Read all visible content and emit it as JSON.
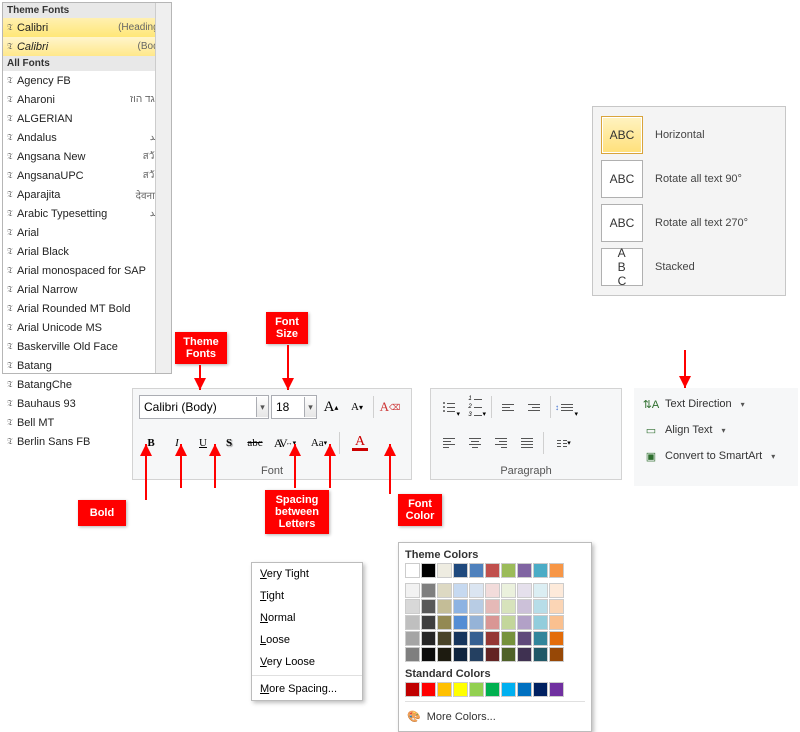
{
  "font_panel": {
    "theme_header": "Theme Fonts",
    "theme_fonts": [
      {
        "name": "Calibri",
        "meta": "(Headings)"
      },
      {
        "name": "Calibri",
        "meta": "(Body)"
      }
    ],
    "all_header": "All Fonts",
    "all_fonts": [
      {
        "name": "Agency FB",
        "meta": ""
      },
      {
        "name": "Aharoni",
        "meta": "אבגד הוז"
      },
      {
        "name": "ALGERIAN",
        "meta": ""
      },
      {
        "name": "Andalus",
        "meta": "أبجد"
      },
      {
        "name": "Angsana New",
        "meta": "สวัสดี"
      },
      {
        "name": "AngsanaUPC",
        "meta": "สวัสดี"
      },
      {
        "name": "Aparajita",
        "meta": "देवनागरी"
      },
      {
        "name": "Arabic Typesetting",
        "meta": "أبجد"
      },
      {
        "name": "Arial",
        "meta": ""
      },
      {
        "name": "Arial Black",
        "meta": ""
      },
      {
        "name": "Arial monospaced for SAP",
        "meta": ""
      },
      {
        "name": "Arial Narrow",
        "meta": ""
      },
      {
        "name": "Arial Rounded MT Bold",
        "meta": ""
      },
      {
        "name": "Arial Unicode MS",
        "meta": ""
      },
      {
        "name": "Baskerville Old Face",
        "meta": ""
      },
      {
        "name": "Batang",
        "meta": ""
      },
      {
        "name": "BatangChe",
        "meta": ""
      },
      {
        "name": "Bauhaus 93",
        "meta": ""
      },
      {
        "name": "Bell MT",
        "meta": ""
      },
      {
        "name": "Berlin Sans FB",
        "meta": ""
      }
    ]
  },
  "text_direction": {
    "items": [
      {
        "thumb": "ABC",
        "label": "Horizontal",
        "key": "H",
        "sel": true
      },
      {
        "thumb": "ABC",
        "label": "Rotate all text 90°",
        "key": "R",
        "sel": false
      },
      {
        "thumb": "ABC",
        "label": "Rotate all text 270°",
        "key": "O",
        "sel": false
      },
      {
        "thumb": "A\nB\nC",
        "label": "Stacked",
        "key": "S",
        "sel": false
      }
    ]
  },
  "font_group": {
    "title": "Font",
    "font_name": "Calibri (Body)",
    "font_size": "18"
  },
  "paragraph_group": {
    "title": "Paragraph"
  },
  "right_stack": {
    "text_dir": "Text Direction",
    "align": "Align Text",
    "smartart": "Convert to SmartArt"
  },
  "callouts": {
    "theme_fonts": "Theme\nFonts",
    "font_size": "Font\nSize",
    "bold": "Bold",
    "spacing": "Spacing\nbetween\nLetters",
    "font_color": "Font\nColor"
  },
  "spacing_menu": {
    "items": [
      "Very Tight",
      "Tight",
      "Normal",
      "Loose",
      "Very Loose"
    ],
    "more": "More Spacing..."
  },
  "color_picker": {
    "theme_head": "Theme Colors",
    "std_head": "Standard Colors",
    "more": "More Colors...",
    "theme_main": [
      "#ffffff",
      "#000000",
      "#eeece1",
      "#1f497d",
      "#4f81bd",
      "#c0504d",
      "#9bbb59",
      "#8064a2",
      "#4bacc6",
      "#f79646"
    ],
    "theme_tints": [
      [
        "#f2f2f2",
        "#7f7f7f",
        "#ddd9c3",
        "#c6d9f0",
        "#dbe5f1",
        "#f2dcdb",
        "#ebf1dd",
        "#e5e0ec",
        "#dbeef3",
        "#fdeada"
      ],
      [
        "#d8d8d8",
        "#595959",
        "#c4bd97",
        "#8db3e2",
        "#b8cce4",
        "#e5b9b7",
        "#d7e3bc",
        "#ccc1d9",
        "#b7dde8",
        "#fbd5b5"
      ],
      [
        "#bfbfbf",
        "#3f3f3f",
        "#938953",
        "#548dd4",
        "#95b3d7",
        "#d99694",
        "#c3d69b",
        "#b2a1c7",
        "#92cddc",
        "#fac08f"
      ],
      [
        "#a5a5a5",
        "#262626",
        "#494429",
        "#17365d",
        "#366092",
        "#953734",
        "#76923c",
        "#5f497a",
        "#31859b",
        "#e36c09"
      ],
      [
        "#7f7f7f",
        "#0c0c0c",
        "#1d1b10",
        "#0f243e",
        "#244061",
        "#632423",
        "#4f6128",
        "#3f3151",
        "#205867",
        "#974806"
      ]
    ],
    "standard": [
      "#c00000",
      "#ff0000",
      "#ffc000",
      "#ffff00",
      "#92d050",
      "#00b050",
      "#00b0f0",
      "#0070c0",
      "#002060",
      "#7030a0"
    ]
  }
}
